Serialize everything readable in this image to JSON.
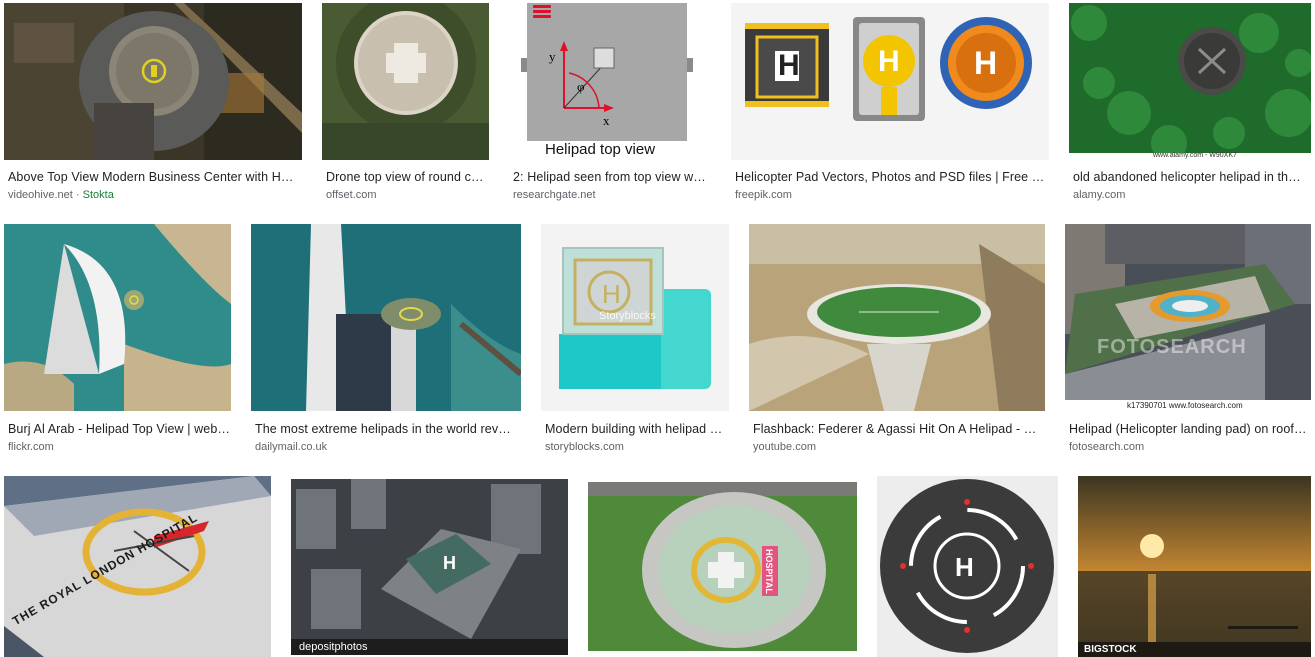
{
  "results": [
    {
      "title": "Above Top View Modern Business Center with He…",
      "source": "videohive.net",
      "source_sep": "·",
      "source_extra": "Stokta",
      "icon": "image-rooftop-helipad-aerial"
    },
    {
      "title": "Drone top view of round c…",
      "source": "offset.com",
      "icon": "image-round-helipad-drone"
    },
    {
      "title": "2: Helipad seen from top view w…",
      "source": "researchgate.net",
      "icon": "image-helipad-diagram",
      "caption": "Helipad top view",
      "label_x": "x",
      "label_y": "y",
      "label_phi": "φ"
    },
    {
      "title": "Helicopter Pad Vectors, Photos and PSD files | Free …",
      "source": "freepik.com",
      "icon": "image-helipad-vectors",
      "glyph": "H"
    },
    {
      "title": "old abandoned helicopter helipad in th…",
      "source": "alamy.com",
      "icon": "image-abandoned-helipad-forest",
      "watermark": "www.alamy.com - W90XK7"
    },
    {
      "title": "Burj Al Arab - Helipad Top View | web…",
      "source": "flickr.com",
      "icon": "image-burj-al-arab"
    },
    {
      "title": "The most extreme helipads in the world rev…",
      "source": "dailymail.co.uk",
      "icon": "image-burj-helipad-closeup"
    },
    {
      "title": "Modern building with helipad …",
      "source": "storyblocks.com",
      "icon": "image-building-helipad-illustration",
      "watermark": "Storyblocks",
      "glyph": "H"
    },
    {
      "title": "Flashback: Federer & Agassi Hit On A Helipad - …",
      "source": "youtube.com",
      "icon": "image-tennis-helipad"
    },
    {
      "title": "Helipad (Helicopter landing pad) on roof…",
      "source": "fotosearch.com",
      "icon": "image-rooftop-helipad-city",
      "watermark": "FOTOSEARCH",
      "watermark_sub": "k17390701   www.fotosearch.com"
    },
    {
      "icon": "image-royal-london-hospital",
      "watermark": "THE ROYAL LONDON HOSPITAL"
    },
    {
      "icon": "image-city-helipad-depositphotos",
      "watermark": "depositphotos",
      "glyph": "H"
    },
    {
      "icon": "image-hospital-helipad",
      "watermark": "HOSPITAL"
    },
    {
      "icon": "image-helipad-icon",
      "glyph": "H"
    },
    {
      "icon": "image-sunset-sea",
      "watermark": "BIGSTOCK"
    }
  ]
}
